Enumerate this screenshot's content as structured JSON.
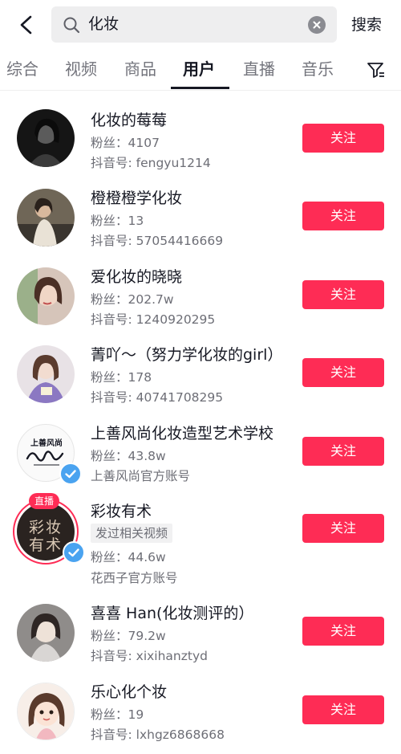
{
  "search": {
    "query": "化妆",
    "submit_label": "搜索"
  },
  "tabs": [
    {
      "label": "综合"
    },
    {
      "label": "视频"
    },
    {
      "label": "商品"
    },
    {
      "label": "用户"
    },
    {
      "label": "直播"
    },
    {
      "label": "音乐"
    }
  ],
  "active_tab": "用户",
  "follow_label": "关注",
  "users": [
    {
      "name": "化妆的莓莓",
      "fans": "粉丝：4107",
      "sub": "抖音号: fengyu1214",
      "avatar_color": "#1b1b1b"
    },
    {
      "name": "橙橙橙学化妆",
      "fans": "粉丝：13",
      "sub": "抖音号: 57054416669",
      "avatar_color": "#7a6f5e"
    },
    {
      "name": "爱化妆的晓晓",
      "fans": "粉丝：202.7w",
      "sub": "抖音号: 1240920295",
      "avatar_color": "#c9b7a9"
    },
    {
      "name": "菁吖～（努力学化妆的girl）",
      "fans": "粉丝：178",
      "sub": "抖音号: 40741708295",
      "avatar_color": "#b9a7b2"
    },
    {
      "name": "上善风尚化妆造型艺术学校",
      "fans": "粉丝：43.8w",
      "sub": "上善风尚官方账号",
      "avatar_color": "#f4f4f4",
      "logo_text": "上善风尚"
    },
    {
      "name": "彩妆有术",
      "tag": "发过相关视频",
      "fans": "粉丝：44.6w",
      "sub": "花西子官方账号",
      "avatar_color": "#2a2320",
      "logo_text": "彩妆有术",
      "live_badge": "直播"
    },
    {
      "name": "喜喜 Han(化妆测评的）",
      "fans": "粉丝：79.2w",
      "sub": "抖音号: xixihanztyd",
      "avatar_color": "#8f8c8a"
    },
    {
      "name": "乐心化个妆",
      "fans": "粉丝：19",
      "sub": "抖音号: lxhgz6868668",
      "avatar_color": "#f3e7df"
    }
  ],
  "colors": {
    "accent": "#fe2c55",
    "verified": "#4aa3f0"
  },
  "icons": [
    "back-arrow-icon",
    "search-icon",
    "clear-icon",
    "filter-icon",
    "verified-icon"
  ]
}
